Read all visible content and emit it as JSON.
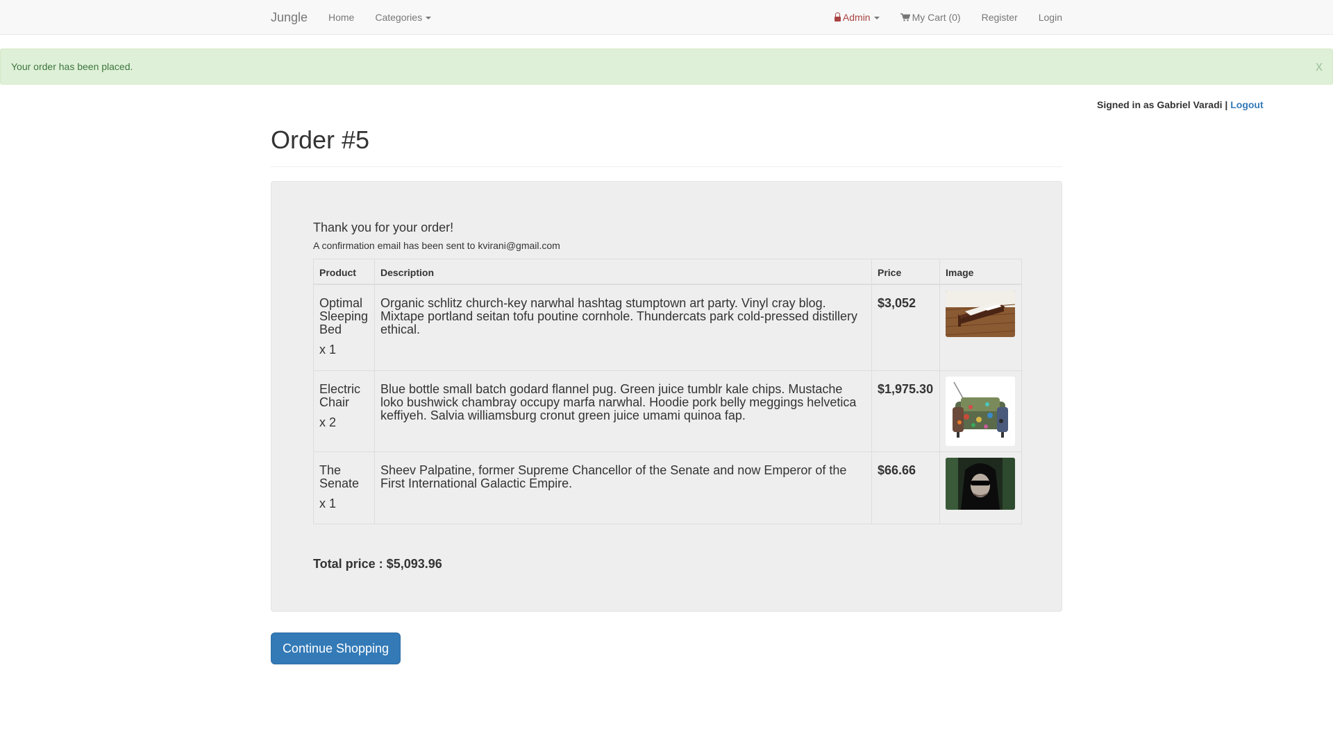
{
  "navbar": {
    "brand": "Jungle",
    "home": "Home",
    "categories": "Categories",
    "admin": "Admin",
    "cart": "My Cart (0)",
    "register": "Register",
    "login": "Login"
  },
  "alert": {
    "message": "Your order has been placed.",
    "close": "x"
  },
  "session": {
    "signed_in_as": "Signed in as Gabriel Varadi |",
    "logout": "Logout"
  },
  "order": {
    "title": "Order #5",
    "thanks": "Thank you for your order!",
    "confirmation_prefix": "A confirmation email has been sent to",
    "email": "kvirani@gmail.com",
    "columns": [
      "Product",
      "Description",
      "Price",
      "Image"
    ],
    "items": [
      {
        "name": "Optimal Sleeping Bed",
        "qty": "x 1",
        "description": "Organic schlitz church-key narwhal hashtag stumptown art party. Vinyl cray blog. Mixtape portland seitan tofu poutine cornhole. Thundercats park cold-pressed distillery ethical.",
        "price": "$3,052",
        "image": "bed-photo"
      },
      {
        "name": "Electric Chair",
        "qty": "x 2",
        "description": "Blue bottle small batch godard flannel pug. Green juice tumblr kale chips. Mustache loko bushwick chambray occupy marfa narwhal. Hoodie pork belly meggings helvetica keffiyeh. Salvia williamsburg cronut green juice umami quinoa fap.",
        "price": "$1,975.30",
        "image": "chair-photo"
      },
      {
        "name": "The Senate",
        "qty": "x 1",
        "description": "Sheev Palpatine, former Supreme Chancellor of the Senate and now Emperor of the First International Galactic Empire.",
        "price": "$66.66",
        "image": "palpatine-photo"
      }
    ],
    "total": "Total price : $5,093.96"
  },
  "actions": {
    "continue": "Continue Shopping"
  }
}
